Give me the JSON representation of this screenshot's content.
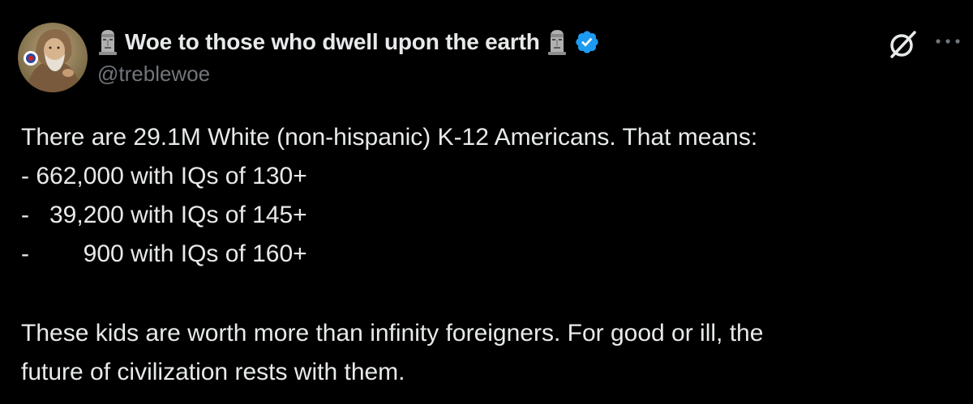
{
  "author": {
    "display_name": "Woe to those who dwell upon the earth",
    "handle": "@treblewoe",
    "verified": true,
    "name_emoji": "moai-icon"
  },
  "header_actions": {
    "grok_icon": "grok-icon",
    "more_icon": "more-dots-icon"
  },
  "post": {
    "lines": [
      "There are 29.1M White (non-hispanic) K-12 Americans. That means:",
      "- 662,000 with IQs of 130+",
      "-   39,200 with IQs of 145+",
      "-        900 with IQs of 160+"
    ],
    "closing_lines": [
      "These kids are worth more than infinity foreigners. For good or ill, the",
      "future of civilization rests with them."
    ]
  },
  "colors": {
    "background": "#000000",
    "text": "#e7e9ea",
    "secondary_text": "#71767b",
    "verified_blue": "#1d9bf0"
  }
}
